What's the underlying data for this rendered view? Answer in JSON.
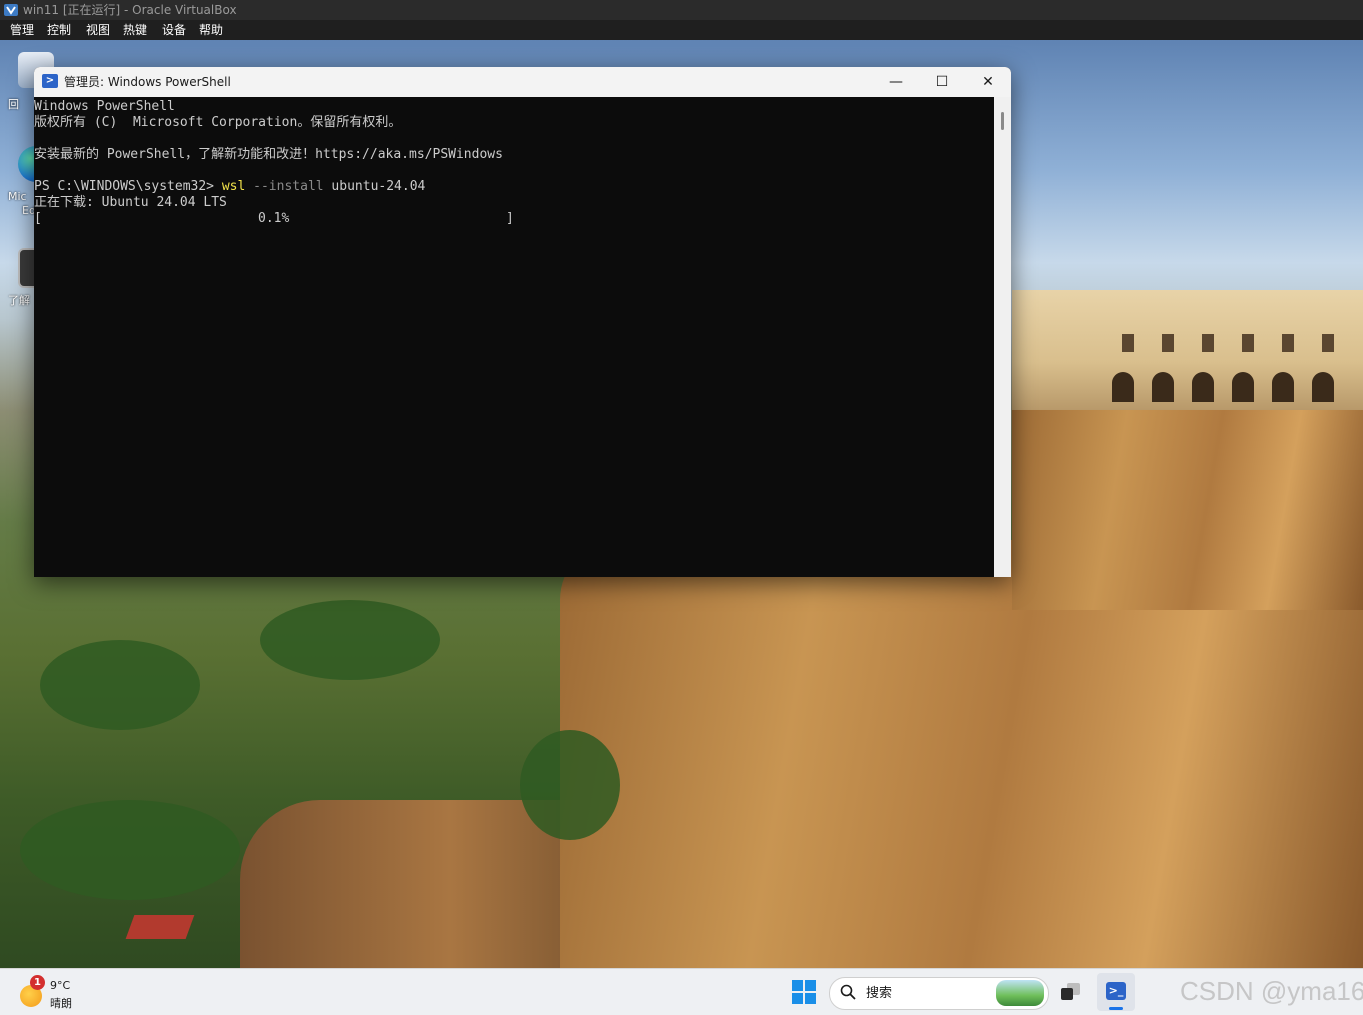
{
  "host": {
    "title": "win11 [正在运行] - Oracle VirtualBox",
    "menu": [
      "管理",
      "控制",
      "视图",
      "热键",
      "设备",
      "帮助"
    ]
  },
  "desktop": {
    "icons": [
      {
        "label": "回",
        "icon": "recycle-bin-icon"
      },
      {
        "label": "Mic",
        "sublabel": "Ed",
        "icon": "edge-icon"
      },
      {
        "label": "了解",
        "icon": "learn-icon"
      }
    ]
  },
  "powershell": {
    "title": "管理员: Windows PowerShell",
    "window_buttons": {
      "minimize": "—",
      "maximize": "☐",
      "close": "✕"
    },
    "console": {
      "banner": "Windows PowerShell",
      "copyright": "版权所有 (C)  Microsoft Corporation。保留所有权利。",
      "install_hint": "安装最新的 PowerShell，了解新功能和改进！https://aka.ms/PSWindows",
      "prompt": "PS C:\\WINDOWS\\system32> ",
      "command": "wsl",
      "param": " --install",
      "arg": " ubuntu-24.04",
      "download_status": "正在下载: Ubuntu 24.04 LTS",
      "progress_bracket_open": "[",
      "progress_text": "0.1%",
      "progress_bracket_close": "]",
      "progress_fraction": 0.001
    }
  },
  "taskbar": {
    "weather": {
      "badge": "1",
      "temp": "9°C",
      "condition": "晴朗"
    },
    "search_placeholder": "搜索",
    "watermark": "CSDN @yma16"
  },
  "colors": {
    "console_bg": "#0c0c0c",
    "console_fg": "#cccccc",
    "command_yellow": "#f0e24a",
    "accent_blue": "#1a8fe8"
  }
}
